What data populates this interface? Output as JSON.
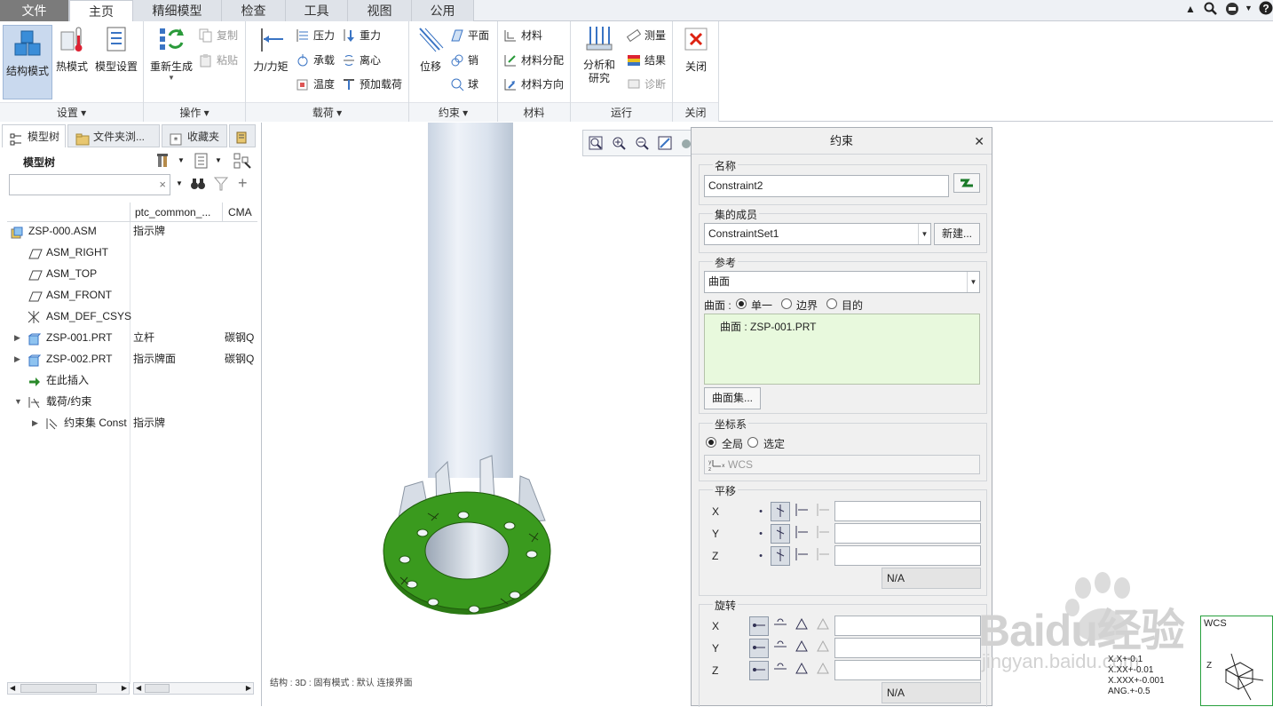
{
  "ribbon_tabs": [
    "文件",
    "主页",
    "精细模型",
    "检查",
    "工具",
    "视图",
    "公用"
  ],
  "ribbon": {
    "settings": {
      "structure_mode": "结构模式",
      "thermal_mode": "热模式",
      "model_setup": "模型设置",
      "label": "设置"
    },
    "operations": {
      "regenerate": "重新生成",
      "copy": "复制",
      "paste": "粘贴",
      "label": "操作"
    },
    "loads": {
      "force_moment": "力/力矩",
      "pressure": "压力",
      "bearing": "承载",
      "temperature": "温度",
      "gravity": "重力",
      "centrifugal": "离心",
      "preload": "预加载荷",
      "label": "载荷"
    },
    "constraints": {
      "displacement": "位移",
      "plane": "平面",
      "pin": "销",
      "ball": "球",
      "label": "约束"
    },
    "materials": {
      "material": "材料",
      "material_assignment": "材料分配",
      "material_orientation": "材料方向",
      "label": "材料"
    },
    "run": {
      "analysis": "分析和研究",
      "measure": "测量",
      "results": "结果",
      "diagnose": "诊断",
      "label": "运行"
    },
    "close": {
      "close": "关闭",
      "label": "关闭"
    }
  },
  "left_panel": {
    "tabs": {
      "model_tree": "模型树",
      "folder_browser": "文件夹浏...",
      "favorites": "收藏夹"
    },
    "header": "模型树",
    "search_value": "",
    "columns": [
      "ptc_common_...",
      "CMA"
    ],
    "rows": [
      {
        "name": "ZSP-000.ASM",
        "col2": "指示牌",
        "col3": ""
      },
      {
        "name": "ASM_RIGHT",
        "col2": "",
        "col3": ""
      },
      {
        "name": "ASM_TOP",
        "col2": "",
        "col3": ""
      },
      {
        "name": "ASM_FRONT",
        "col2": "",
        "col3": ""
      },
      {
        "name": "ASM_DEF_CSYS",
        "col2": "",
        "col3": ""
      },
      {
        "name": "ZSP-001.PRT",
        "col2": "立杆",
        "col3": "碳钢Q"
      },
      {
        "name": "ZSP-002.PRT",
        "col2": "指示牌面",
        "col3": "碳钢Q"
      },
      {
        "name": "在此插入",
        "col2": "",
        "col3": ""
      },
      {
        "name": "载荷/约束",
        "col2": "",
        "col3": ""
      },
      {
        "name": "约束集 Const",
        "col2": "指示牌",
        "col3": ""
      }
    ]
  },
  "viewport": {
    "status_line": "结构 : 3D : 固有模式 : 默认 连接界面",
    "wcs_label": "WCS",
    "readout": [
      "X.X+-0.1",
      "X.XX+-0.01",
      "X.XXX+-0.001",
      "ANG.+-0.5"
    ],
    "watermark": "Baidu经验",
    "watermark_url": "jingyan.baidu.com",
    "colors": {
      "post": "#dfe6f0",
      "flange": "#3a9a1e",
      "wcs_border": "#27a03d"
    }
  },
  "dialog": {
    "title": "约束",
    "name_section": "名称",
    "name_value": "Constraint2",
    "set_section": "集的成员",
    "set_value": "ConstraintSet1",
    "new_button": "新建...",
    "ref_section": "参考",
    "ref_type": "曲面",
    "surface_label": "曲面 :",
    "surface_options": [
      "单一",
      "边界",
      "目的"
    ],
    "surface_selected": "单一",
    "ref_item": "曲面 : ZSP-001.PRT",
    "surface_set_button": "曲面集...",
    "csys_section": "坐标系",
    "csys_options": [
      "全局",
      "选定"
    ],
    "csys_selected": "全局",
    "csys_value": "WCS",
    "translation_section": "平移",
    "rotation_section": "旋转",
    "axes": [
      "X",
      "Y",
      "Z"
    ],
    "translation_na": "N/A",
    "rotation_na": "N/A"
  }
}
